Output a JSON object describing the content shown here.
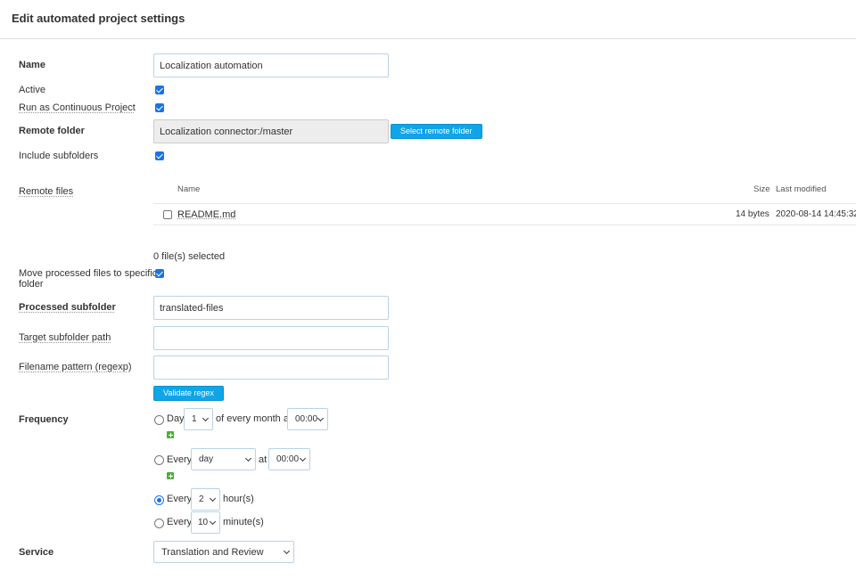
{
  "header": {
    "title": "Edit automated project settings"
  },
  "form": {
    "name": {
      "label": "Name",
      "value": "Localization automation"
    },
    "active": {
      "label": "Active",
      "checked": true
    },
    "continuous": {
      "label": "Run as Continuous Project",
      "checked": true
    },
    "remote_folder": {
      "label": "Remote folder",
      "value": "Localization connector:/master",
      "button": "Select remote folder"
    },
    "include_subfolders": {
      "label": "Include subfolders",
      "checked": true
    },
    "remote_files": {
      "label": "Remote files",
      "columns": {
        "name": "Name",
        "size": "Size",
        "modified": "Last modified"
      },
      "rows": [
        {
          "name": "README.md",
          "size": "14 bytes",
          "modified": "2020-08-14 14:45:32",
          "checked": false
        }
      ],
      "selected_count": "0 file(s) selected"
    },
    "move_processed": {
      "label_line1": "Move processed files to specific",
      "label_line2": "folder",
      "checked": true
    },
    "processed_subfolder": {
      "label": "Processed subfolder",
      "value": "translated-files"
    },
    "target_subfolder": {
      "label": "Target subfolder path",
      "value": ""
    },
    "filename_pattern": {
      "label": "Filename pattern (regexp)",
      "value": "",
      "button": "Validate regex"
    },
    "frequency": {
      "label": "Frequency",
      "opt_month": {
        "prefix": "Day",
        "day": "1",
        "middle": "of every month at",
        "time": "00:00",
        "selected": false
      },
      "opt_day": {
        "prefix": "Every",
        "unit": "day",
        "middle": "at",
        "time": "00:00",
        "selected": false
      },
      "opt_hour": {
        "prefix": "Every",
        "value": "2",
        "suffix": "hour(s)",
        "selected": true
      },
      "opt_minute": {
        "prefix": "Every",
        "value": "10",
        "suffix": "minute(s)",
        "selected": false
      }
    },
    "service": {
      "label": "Service",
      "value": "Translation and Review"
    }
  },
  "colors": {
    "accent": "#0ea5e9",
    "checkbox": "#1a73e8",
    "add": "#4cae3b"
  },
  "icons": {
    "add": "plus-icon",
    "dropdown": "chevron-down-icon"
  }
}
